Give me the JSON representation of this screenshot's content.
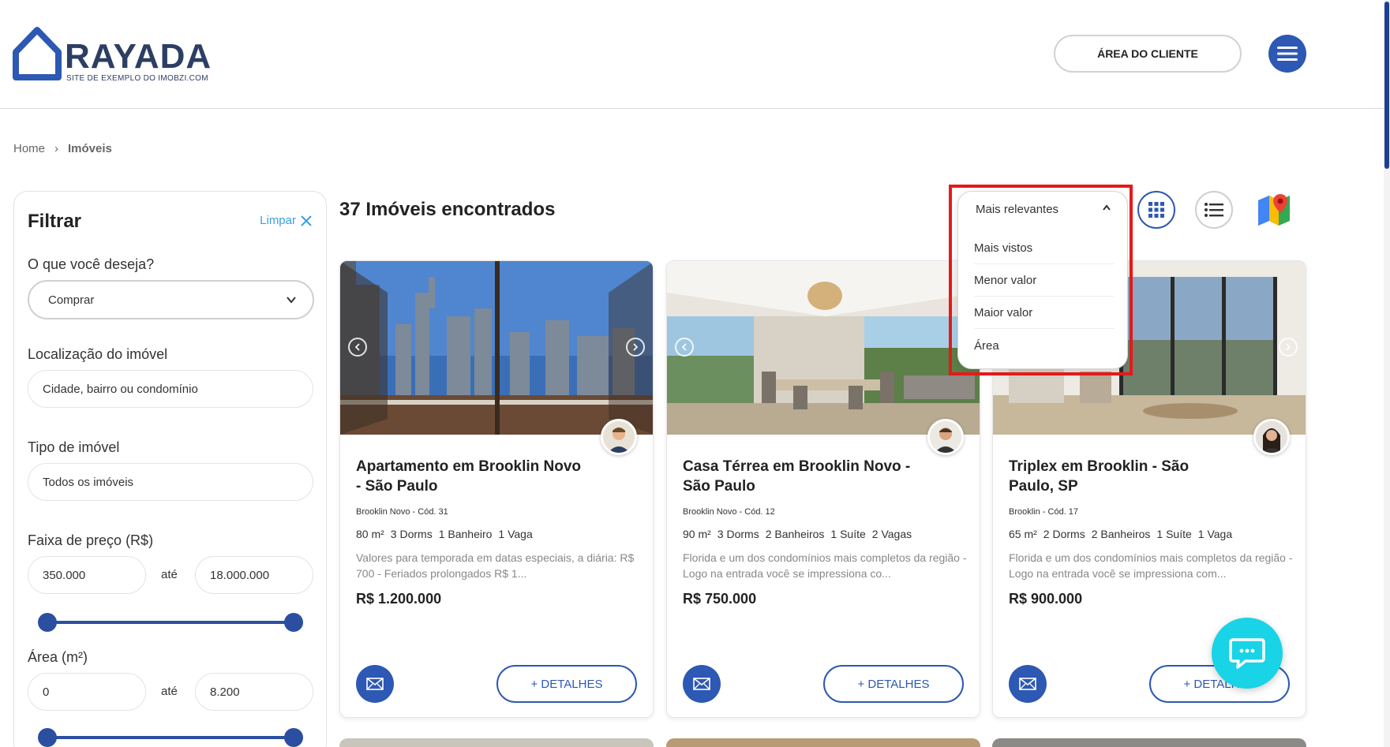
{
  "header": {
    "logo_text": "RAYADA",
    "logo_sub": "SITE DE EXEMPLO DO IMOBZI.COM",
    "client_area": "ÁREA DO CLIENTE",
    "menu_icon": "hamburger-icon"
  },
  "breadcrumb": {
    "home": "Home",
    "separator": "›",
    "current": "Imóveis"
  },
  "filter": {
    "title": "Filtrar",
    "clear": "Limpar",
    "want_label": "O que você deseja?",
    "want_value": "Comprar",
    "location_label": "Localização do imóvel",
    "location_placeholder": "Cidade, bairro ou condomínio",
    "type_label": "Tipo de imóvel",
    "type_value": "Todos os imóveis",
    "price_label": "Faixa de preço (R$)",
    "price_min": "350.000",
    "price_max": "18.000.000",
    "price_sep": "até",
    "area_label": "Área (m²)",
    "area_min": "0",
    "area_max": "8.200",
    "area_sep": "até"
  },
  "results": {
    "title": "37 Imóveis encontrados"
  },
  "sort": {
    "selected": "Mais relevantes",
    "options": [
      "Mais vistos",
      "Menor valor",
      "Maior valor",
      "Área"
    ]
  },
  "cards": [
    {
      "title": "Apartamento em Brooklin Novo - São Paulo",
      "location": "Brooklin Novo - Cód. 31",
      "features": [
        "80 m²",
        "3 Dorms",
        "1 Banheiro",
        "1 Vaga"
      ],
      "description": "Valores para temporada em datas especiais, a diária: R$ 700 - Feriados prolongados R$ 1...",
      "price": "R$ 1.200.000",
      "details": "+ DETALHES"
    },
    {
      "title": "Casa Térrea em Brooklin Novo - São Paulo",
      "location": "Brooklin Novo - Cód. 12",
      "features": [
        "90 m²",
        "3 Dorms",
        "2 Banheiros",
        "1 Suíte",
        "2 Vagas"
      ],
      "description": "Florida e um dos condomínios mais completos da região - Logo na entrada você se impressiona co...",
      "price": "R$ 750.000",
      "details": "+ DETALHES"
    },
    {
      "title": "Triplex em Brooklin - São Paulo, SP",
      "location": "Brooklin - Cód. 17",
      "features": [
        "65 m²",
        "2 Dorms",
        "2 Banheiros",
        "1 Suíte",
        "1 Vaga"
      ],
      "description": "Florida e um dos condomínios mais completos da região - Logo na entrada você se impressiona com...",
      "price": "R$ 900.000",
      "details": "+ DETALHES"
    }
  ],
  "colors": {
    "primary": "#2d58b3",
    "accent_link": "#3aa0e0",
    "chat": "#19d3e6",
    "highlight": "#e41a1a"
  }
}
